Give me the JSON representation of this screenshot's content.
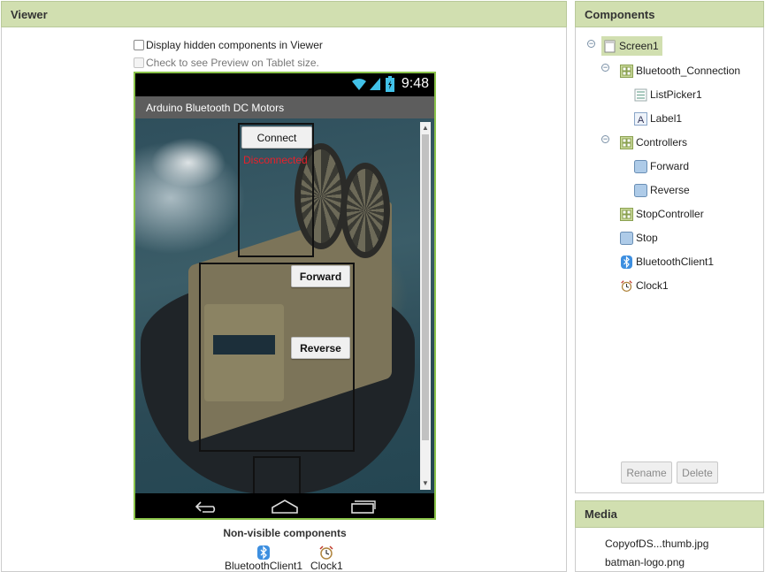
{
  "viewer": {
    "title": "Viewer",
    "options": {
      "show_hidden_label": "Display hidden components in Viewer",
      "tablet_preview_label": "Check to see Preview on Tablet size."
    },
    "phone": {
      "status_time": "9:48",
      "app_title": "Arduino Bluetooth DC Motors",
      "connect_label": "Connect",
      "connection_status": "Disconnected",
      "forward_label": "Forward",
      "reverse_label": "Reverse"
    },
    "non_visible": {
      "title": "Non-visible components",
      "items": [
        "BluetoothClient1",
        "Clock1"
      ]
    }
  },
  "components": {
    "title": "Components",
    "tree": [
      {
        "label": "Screen1",
        "type": "screen"
      },
      {
        "label": "Bluetooth_Connection",
        "type": "arrangement"
      },
      {
        "label": "ListPicker1",
        "type": "listpicker"
      },
      {
        "label": "Label1",
        "type": "label"
      },
      {
        "label": "Controllers",
        "type": "arrangement"
      },
      {
        "label": "Forward",
        "type": "button"
      },
      {
        "label": "Reverse",
        "type": "button"
      },
      {
        "label": "StopController",
        "type": "arrangement"
      },
      {
        "label": "Stop",
        "type": "button"
      },
      {
        "label": "BluetoothClient1",
        "type": "bluetooth"
      },
      {
        "label": "Clock1",
        "type": "clock"
      }
    ],
    "rename_label": "Rename",
    "delete_label": "Delete"
  },
  "media": {
    "title": "Media",
    "items": [
      "CopyofDS...thumb.jpg",
      "batman-logo.png"
    ]
  },
  "colors": {
    "header_bg": "#d1dfb0",
    "phone_border": "#8bc34a",
    "status_red": "#e8202a"
  }
}
